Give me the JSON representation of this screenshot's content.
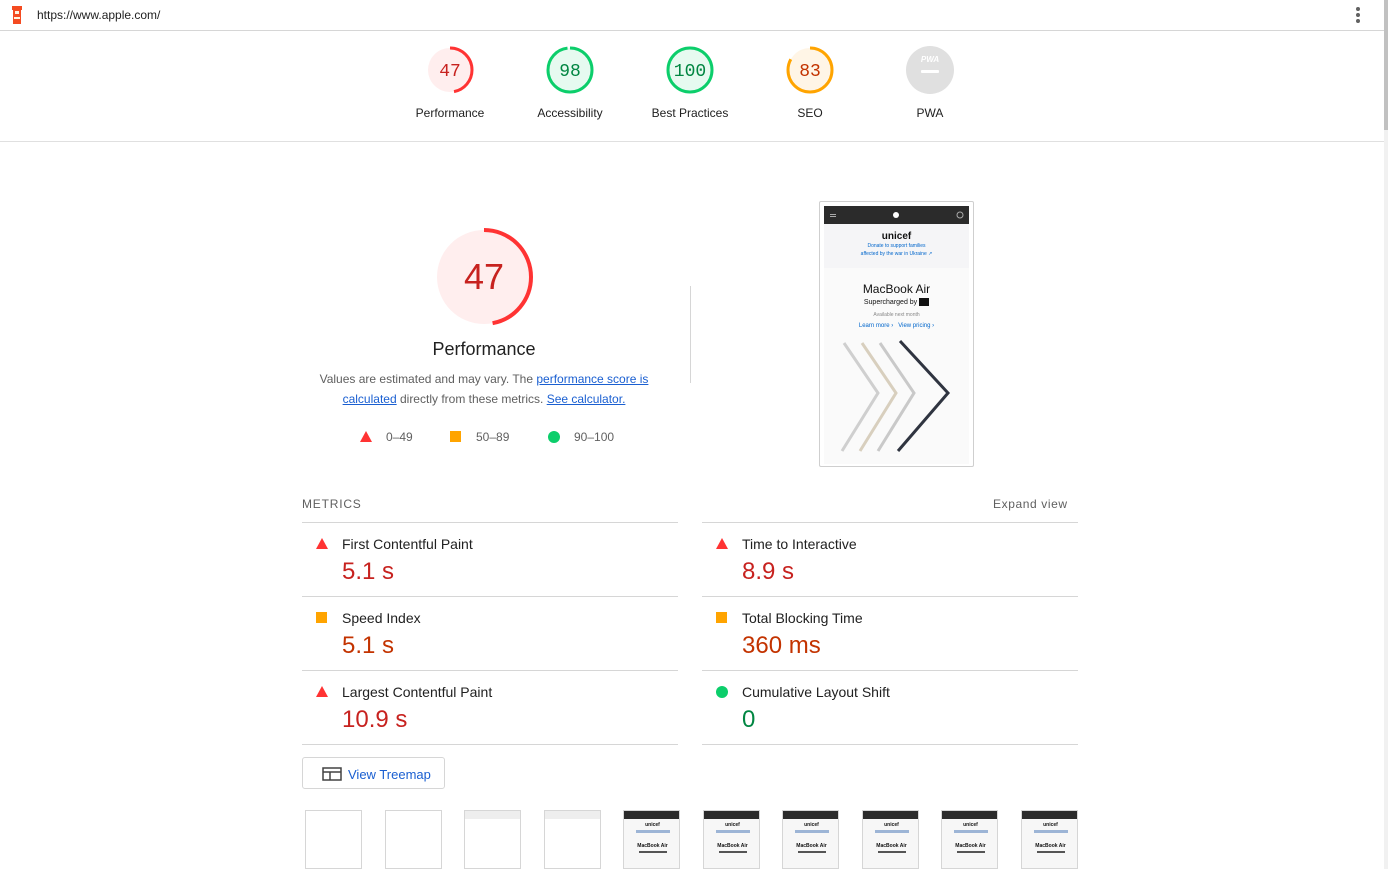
{
  "header": {
    "url": "https://www.apple.com/"
  },
  "gauges": [
    {
      "label": "Performance",
      "score": "47",
      "fraction": 0.47,
      "color": "#ff3333",
      "fill": "#ffeeee",
      "text_color": "#c7221f"
    },
    {
      "label": "Accessibility",
      "score": "98",
      "fraction": 0.98,
      "color": "#0cce6b",
      "fill": "#e6faf0",
      "text_color": "#018642"
    },
    {
      "label": "Best Practices",
      "score": "100",
      "fraction": 1.0,
      "color": "#0cce6b",
      "fill": "#e6faf0",
      "text_color": "#018642"
    },
    {
      "label": "SEO",
      "score": "83",
      "fraction": 0.83,
      "color": "#ffa400",
      "fill": "#fff5e6",
      "text_color": "#c33300"
    },
    {
      "label": "PWA",
      "score": "PWA",
      "fraction": 0,
      "color": "#e0e0e0",
      "fill": "#e0e0e0",
      "text_color": "#ffffff"
    }
  ],
  "performance": {
    "score": "47",
    "fraction": 0.47,
    "title": "Performance",
    "desc_prefix": "Values are estimated and may vary. The ",
    "link1": "performance score is calculated",
    "desc_middle": " directly from these metrics. ",
    "link2": "See calculator.",
    "legend": [
      {
        "range": "0–49",
        "shape": "triangle",
        "color": "#ff3333"
      },
      {
        "range": "50–89",
        "shape": "square",
        "color": "#ffa400"
      },
      {
        "range": "90–100",
        "shape": "circle",
        "color": "#0cce6b"
      }
    ]
  },
  "screenshot": {
    "banner_title": "unicef",
    "banner_line1": "Donate to support families",
    "banner_line2": "affected by the war in Ukraine ↗",
    "heading": "MacBook Air",
    "sub": "Supercharged by",
    "available": "Available next month",
    "link1": "Learn more ›",
    "link2": "View pricing ›"
  },
  "metrics": {
    "heading": "METRICS",
    "expand": "Expand view",
    "left": [
      {
        "name": "First Contentful Paint",
        "value": "5.1 s",
        "rating": "fail"
      },
      {
        "name": "Speed Index",
        "value": "5.1 s",
        "rating": "average"
      },
      {
        "name": "Largest Contentful Paint",
        "value": "10.9 s",
        "rating": "fail"
      }
    ],
    "right": [
      {
        "name": "Time to Interactive",
        "value": "8.9 s",
        "rating": "fail"
      },
      {
        "name": "Total Blocking Time",
        "value": "360 ms",
        "rating": "average"
      },
      {
        "name": "Cumulative Layout Shift",
        "value": "0",
        "rating": "pass"
      }
    ]
  },
  "treemap": {
    "label": "View Treemap"
  },
  "filmstrip": {
    "frames": [
      "blank",
      "blank",
      "gray",
      "gray",
      "page",
      "page",
      "page",
      "page",
      "page",
      "page"
    ],
    "page_title": "unicef",
    "page_heading": "MacBook Air"
  }
}
